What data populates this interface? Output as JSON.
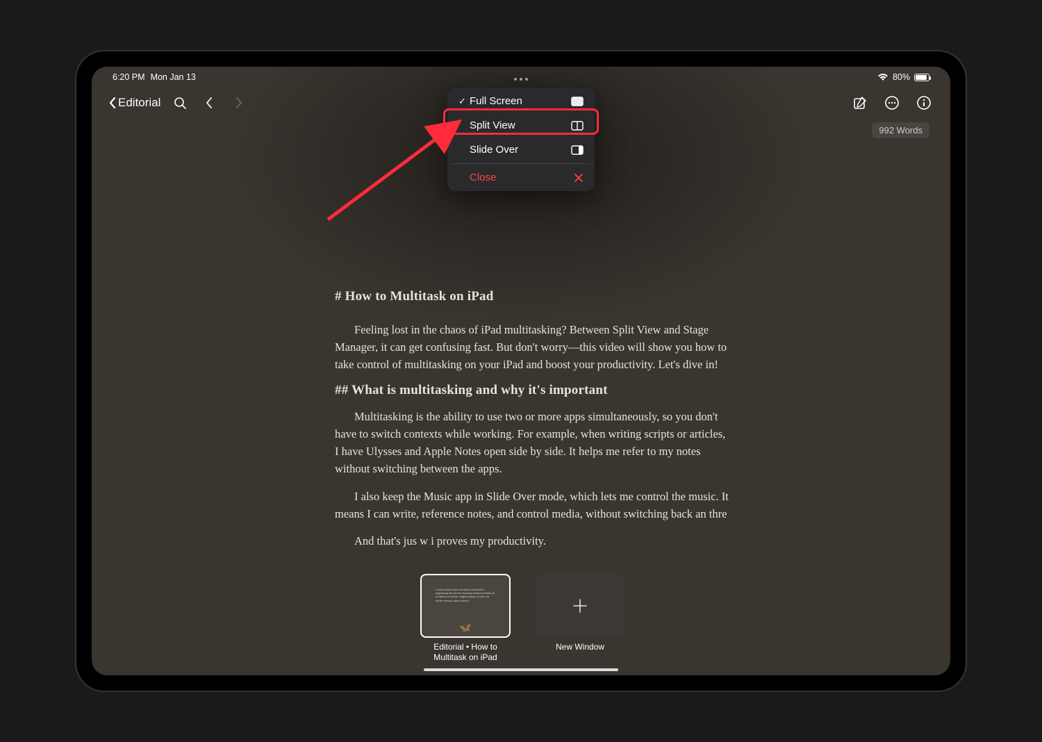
{
  "status": {
    "time": "6:20 PM",
    "date": "Mon Jan 13",
    "battery": "80%"
  },
  "toolbar": {
    "back_label": "Editorial",
    "word_count": "992 Words"
  },
  "menu": {
    "items": [
      {
        "label": "Full Screen",
        "checked": true,
        "icon": "fullscreen-icon"
      },
      {
        "label": "Split View",
        "checked": false,
        "icon": "splitview-icon",
        "highlight": true
      },
      {
        "label": "Slide Over",
        "checked": false,
        "icon": "slideover-icon"
      }
    ],
    "close_label": "Close"
  },
  "content": {
    "h1": "# How to Multitask on iPad",
    "p1": "Feeling lost in the chaos of iPad multitasking? Between Split View and Stage Manager, it can get confusing fast. But don't worry—this video will show you how to take control of multitasking on your iPad and boost your productivity. Let's dive in!",
    "h2": "## What is multitasking and why it's important",
    "p2": "Multitasking is the ability to use two or more apps simultaneously, so you don't have to switch contexts while working. For example, when writing scripts or articles, I have Ulysses and Apple Notes open side by side. It helps me refer to my notes without switching between the apps.",
    "p3": "I also keep the Music app in Slide Over mode, which lets me control the music. It means I can write, reference notes, and control media, without switching back an                                    thre",
    "p4": "And that's jus                                             w i                             proves my productivity."
  },
  "shelf": {
    "item1_label": "Editorial • How to Multitask on iPad",
    "item2_label": "New Window"
  }
}
